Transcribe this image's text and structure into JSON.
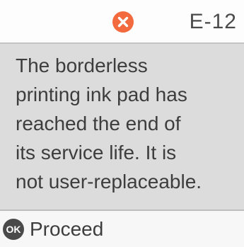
{
  "header": {
    "error_icon": "error-x-icon",
    "error_icon_color": "#f26a3d",
    "error_code": "E-12"
  },
  "message": {
    "text": "The borderless\nprinting ink pad has\nreached the end of\nits service life. It is\nnot user-replaceable."
  },
  "footer": {
    "ok_icon_label": "OK",
    "proceed_label": "Proceed"
  },
  "colors": {
    "message_background": "#dcdcdc",
    "accent_error": "#f26a3d"
  }
}
